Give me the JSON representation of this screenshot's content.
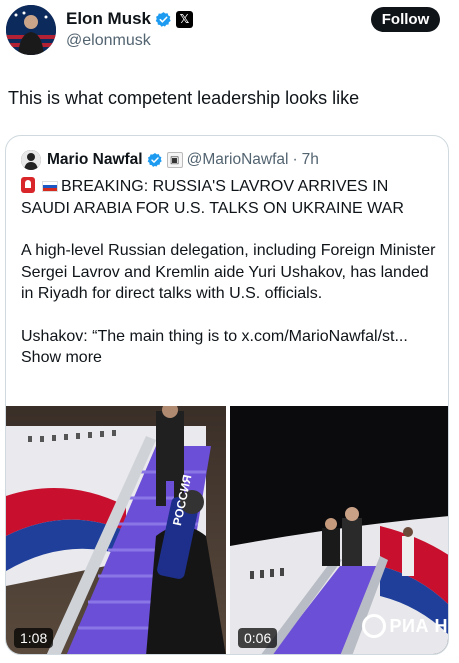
{
  "author": {
    "display_name": "Elon Musk",
    "handle": "@elonmusk",
    "follow_label": "Follow"
  },
  "tweet": {
    "text": "This is what competent leadership looks like"
  },
  "quoted": {
    "display_name": "Mario Nawfal",
    "handle": "@MarioNawfal",
    "separator": "·",
    "time": "7h",
    "headline": "BREAKING: RUSSIA'S LAVROV ARRIVES IN SAUDI ARABIA FOR U.S. TALKS ON UKRAINE WAR",
    "paragraph": "A high-level Russian delegation, including Foreign Minister Sergei Lavrov and Kremlin aide Yuri Ushakov, has landed in Riyadh for direct talks with U.S. officials.",
    "quote_line": "Ushakov: “The main thing is to x.com/MarioNawfal/st...",
    "show_more": "Show more",
    "media": [
      {
        "duration": "1:08",
        "mic_label": "РОССИЯ"
      },
      {
        "duration": "0:06",
        "watermark": "РИА Н"
      }
    ]
  },
  "colors": {
    "text": "#0f1419",
    "secondary": "#536471",
    "verified_blue": "#1d9bf0",
    "border": "#cfd9de",
    "stair_purple": "#6b4fd6"
  },
  "icons": {
    "verified": "verified-badge-icon",
    "x_affiliation": "x-logo-icon",
    "siren": "siren-emoji",
    "flag": "russia-flag-emoji"
  }
}
